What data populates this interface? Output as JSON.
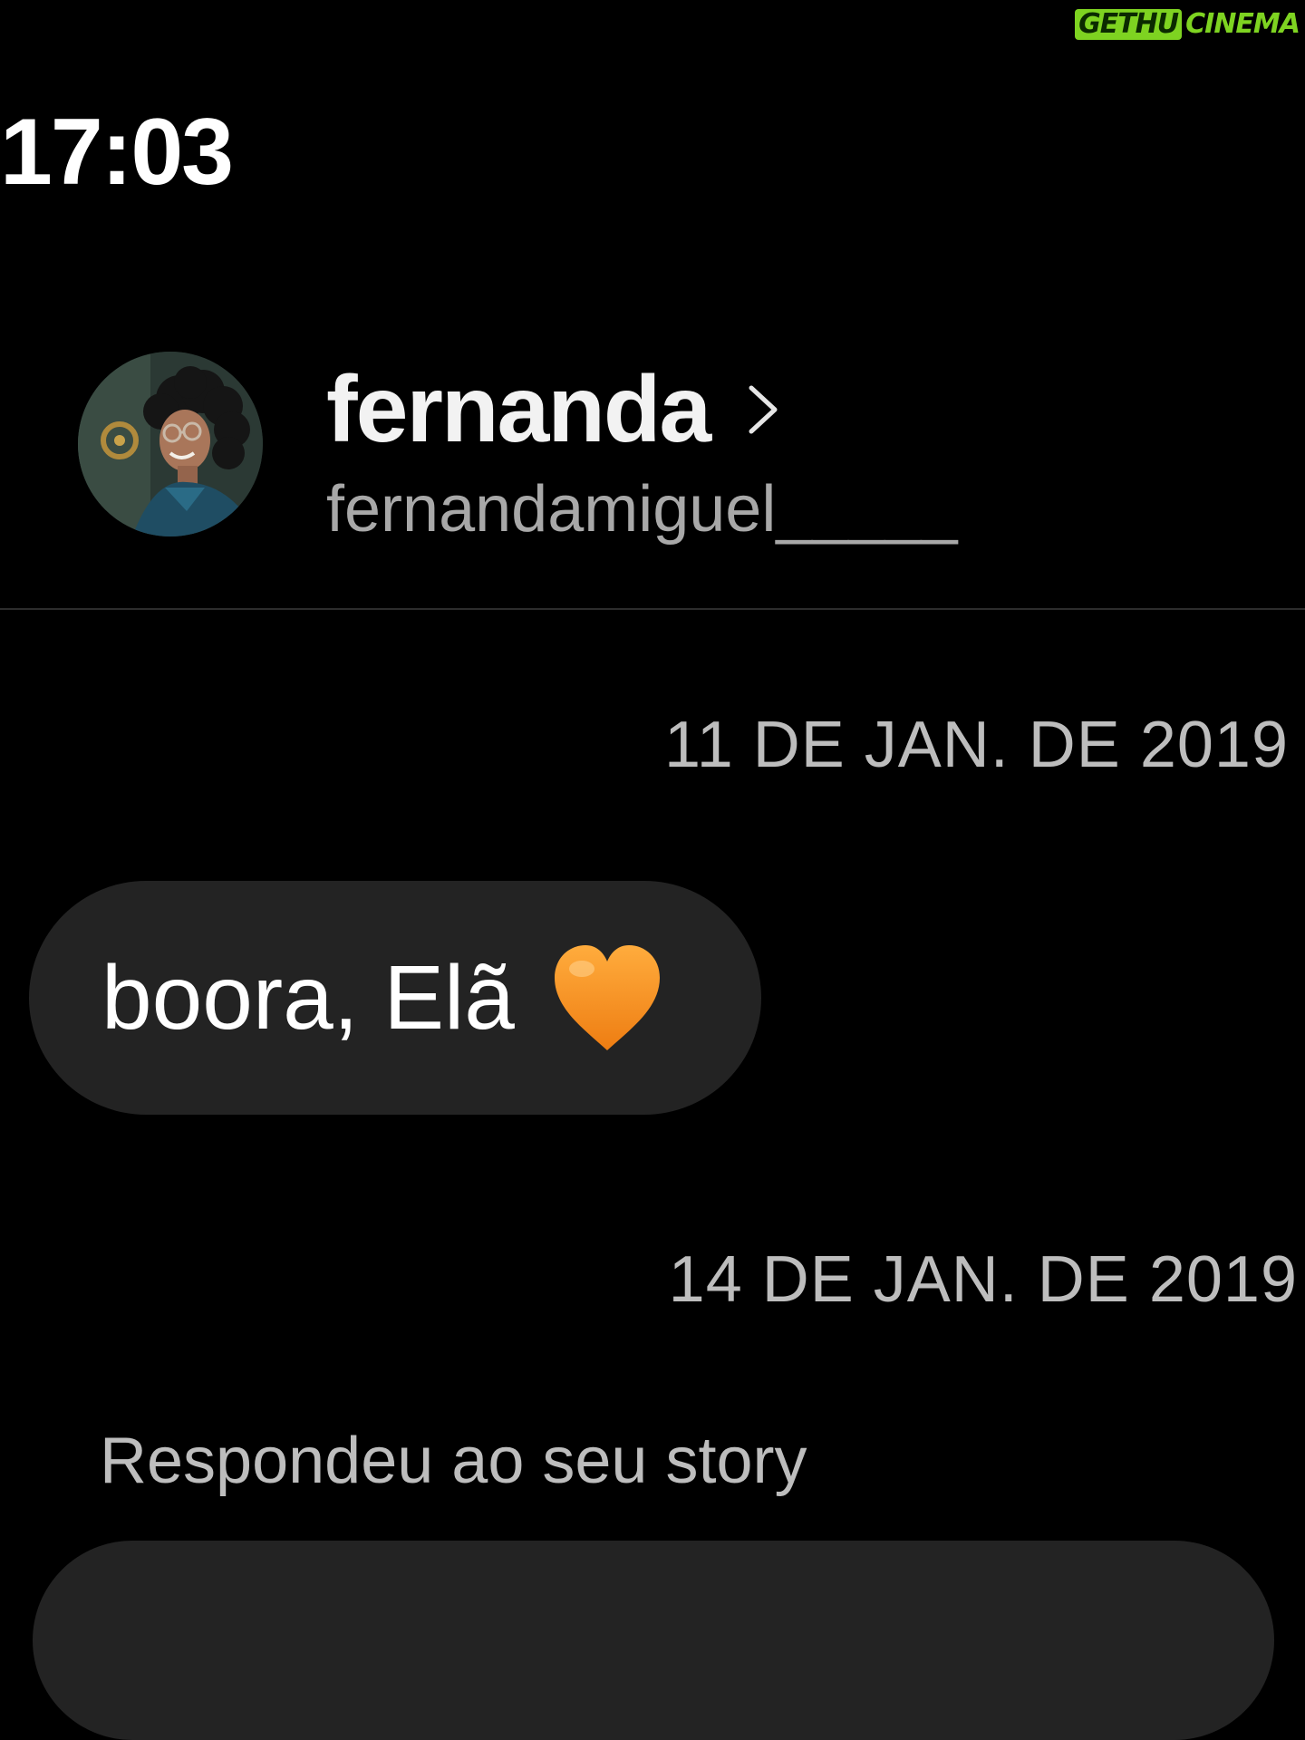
{
  "watermark": {
    "left_text": "GETHU",
    "right_text": "CINEMA",
    "brand_color": "#7ed321"
  },
  "status_bar": {
    "time": "17:03"
  },
  "header": {
    "contact_name": "fernanda",
    "username": "fernandamiguel_____",
    "chevron_icon": "chevron-right-icon",
    "avatar_icon": "profile-photo"
  },
  "thread": {
    "date_1": "11 DE JAN. DE 2019",
    "message_1": {
      "text": "boora, Elã",
      "emoji": "orange-heart-icon",
      "emoji_color": "#f5891f"
    },
    "date_2": "14 DE JAN. DE 2019",
    "story_reply_label": "Respondeu ao seu story",
    "message_2": {
      "text": ""
    }
  },
  "colors": {
    "background": "#000000",
    "bubble": "#232323",
    "secondary_text": "#a8a8a8",
    "divider": "#2c2c2c"
  }
}
